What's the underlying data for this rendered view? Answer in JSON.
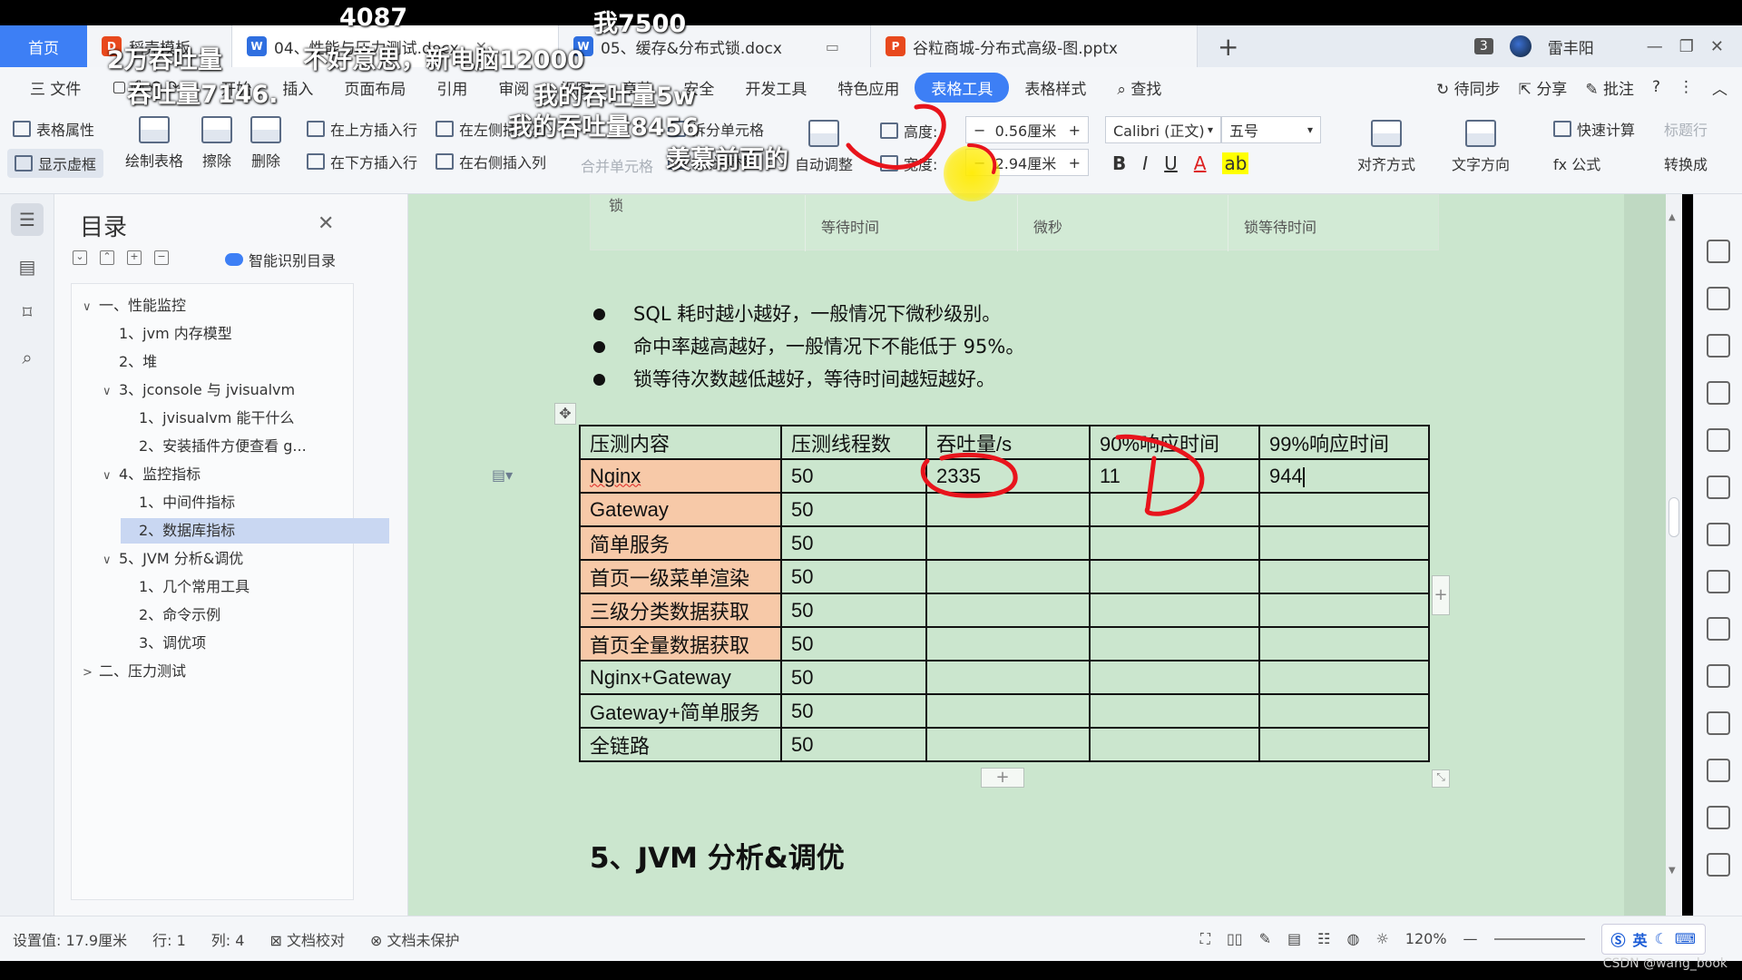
{
  "tabs": {
    "home": "首页",
    "doc1": "稻壳模板",
    "doc2": "04、性能与压力测试.docx",
    "doc3": "05、缓存&分布式锁.docx",
    "doc4": "谷粒商城-分布式高级-图.pptx",
    "new_tab": "+",
    "count_badge": "3",
    "user_name": "雷丰阳"
  },
  "menubar": {
    "file": "三 文件",
    "items": [
      "开始",
      "插入",
      "页面布局",
      "引用",
      "审阅",
      "视图",
      "章节",
      "安全",
      "开发工具",
      "特色应用"
    ],
    "active": "表格工具",
    "table_style": "表格样式",
    "search": "查找",
    "sync": "待同步",
    "share": "分享",
    "comment": "批注"
  },
  "ribbon": {
    "table_props": "表格属性",
    "show_grid": "显示虚框",
    "draw_table": "绘制表格",
    "erase": "擦除",
    "delete": "删除",
    "insert_above": "在上方插入行",
    "insert_below": "在下方插入行",
    "insert_left": "在左侧插入列",
    "insert_right": "在右侧插入列",
    "merge": "合并单元格",
    "split_cell": "拆分单元格",
    "split_table": "拆分表格",
    "autofit": "自动调整",
    "height_label": "高度:",
    "height_value": "0.56厘米",
    "width_label": "宽度:",
    "width_value": "2.94厘米",
    "font": "Calibri (正文)",
    "size": "五号",
    "bold": "B",
    "italic": "I",
    "underline": "U",
    "font_color": "A",
    "align": "对齐方式",
    "text_dir": "文字方向",
    "quick_calc": "快速计算",
    "title_row": "标题行",
    "formula": "fx 公式",
    "convert": "转换成"
  },
  "outline": {
    "title": "目录",
    "smart": "智能识别目录",
    "items": [
      {
        "label": "一、性能监控",
        "caret": "∨"
      },
      {
        "label": "1、jvm 内存模型",
        "caret": ""
      },
      {
        "label": "2、堆",
        "caret": ""
      },
      {
        "label": "3、jconsole 与 jvisualvm",
        "caret": "∨"
      },
      {
        "label": "1、jvisualvm 能干什么",
        "caret": ""
      },
      {
        "label": "2、安装插件方便查看 g...",
        "caret": ""
      },
      {
        "label": "4、监控指标",
        "caret": "∨"
      },
      {
        "label": "1、中间件指标",
        "caret": ""
      },
      {
        "label": "2、数据库指标",
        "caret": ""
      },
      {
        "label": "5、JVM 分析&调优",
        "caret": "∨"
      },
      {
        "label": "1、几个常用工具",
        "caret": ""
      },
      {
        "label": "2、命令示例",
        "caret": ""
      },
      {
        "label": "3、调优项",
        "caret": ""
      },
      {
        "label": "二、压力测试",
        "caret": ">"
      }
    ]
  },
  "doc": {
    "prev_table": {
      "row_label": "锁",
      "c1": "等待时间",
      "c2": "微秒",
      "c3": "锁等待时间"
    },
    "bullets": [
      "SQL 耗时越小越好，一般情况下微秒级别。",
      "命中率越高越好，一般情况下不能低于 95%。",
      "锁等待次数越低越好，等待时间越短越好。"
    ],
    "table": {
      "headers": [
        "压测内容",
        "压测线程数",
        "吞吐量/s",
        "90%响应时间",
        "99%响应时间"
      ],
      "rows": [
        [
          "Nginx",
          "50",
          "2335",
          "11",
          "944"
        ],
        [
          "Gateway",
          "50",
          "",
          "",
          ""
        ],
        [
          "简单服务",
          "50",
          "",
          "",
          ""
        ],
        [
          "首页一级菜单渲染",
          "50",
          "",
          "",
          ""
        ],
        [
          "三级分类数据获取",
          "50",
          "",
          "",
          ""
        ],
        [
          "首页全量数据获取",
          "50",
          "",
          "",
          ""
        ],
        [
          "Nginx+Gateway",
          "50",
          "",
          "",
          ""
        ],
        [
          "Gateway+简单服务",
          "50",
          "",
          "",
          ""
        ],
        [
          "全链路",
          "50",
          "",
          "",
          ""
        ]
      ]
    },
    "heading": "5、JVM 分析&调优"
  },
  "statusbar": {
    "setting": "设置值: 17.9厘米",
    "row": "行: 1",
    "col": "列: 4",
    "proof": "文档校对",
    "protect": "文档未保护",
    "zoom": "120%",
    "ime": "英"
  },
  "danmu": [
    "4087",
    "我7500",
    "2万吞吐量",
    "不好意思，新电脑12000",
    "吞吐量7146.",
    "我的吞吐量5w",
    "我的吞吐量8456",
    "羡慕前面的"
  ],
  "watermark": "CSDN @wang_book",
  "colors": {
    "accent": "#3d7ff5",
    "page_bg": "#cbe6ce",
    "highlight_cell": "#f7c9a8",
    "annotation": "#e8141c"
  }
}
